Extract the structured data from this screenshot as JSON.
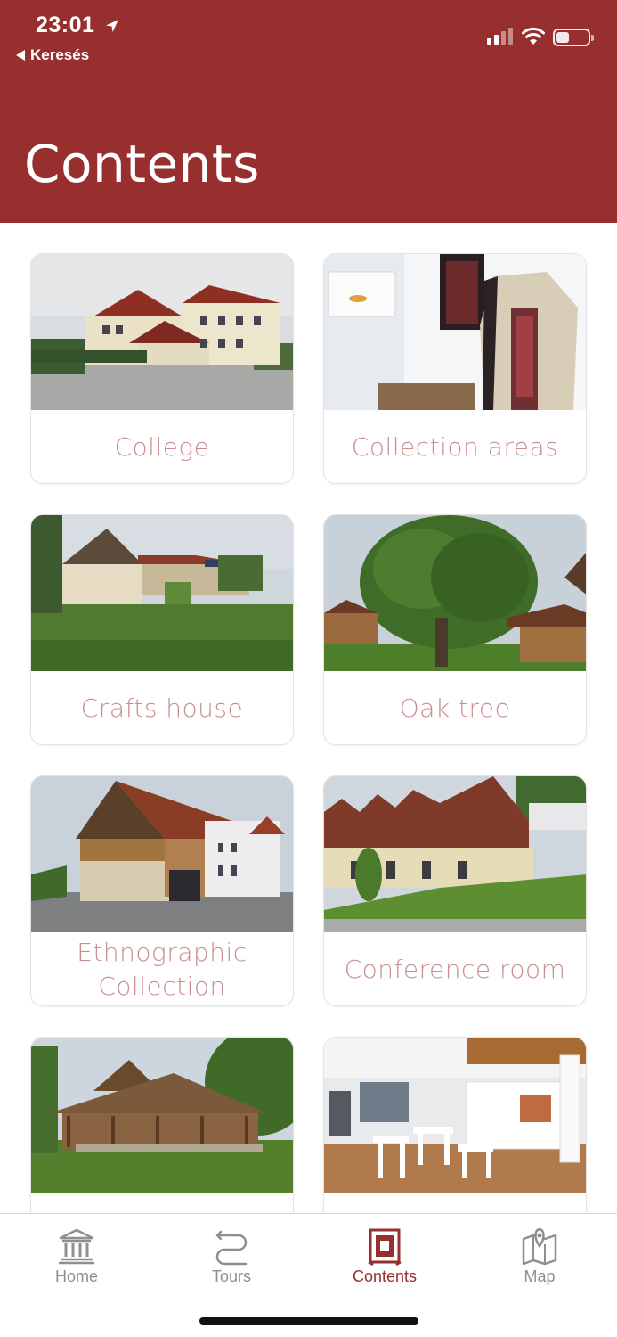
{
  "status_bar": {
    "time": "23:01",
    "back_label": "Keresés"
  },
  "header": {
    "title": "Contents"
  },
  "colors": {
    "brand": "#972f2e",
    "card_label": "#c98e90",
    "tab_inactive": "#8e8e93"
  },
  "cards": [
    {
      "label": "College",
      "image": "college-building-photo"
    },
    {
      "label": "Collection areas",
      "image": "exhibition-room-photo"
    },
    {
      "label": "Crafts house",
      "image": "crafts-house-photo"
    },
    {
      "label": "Oak tree",
      "image": "oak-tree-photo"
    },
    {
      "label": "Ethnographic Collection",
      "image": "wooden-barn-photo"
    },
    {
      "label": "Conference room",
      "image": "conference-building-photo"
    },
    {
      "label": "",
      "image": "wooden-pavilion-photo"
    },
    {
      "label": "",
      "image": "cafe-interior-photo"
    }
  ],
  "tabbar": {
    "items": [
      {
        "label": "Home",
        "icon": "museum-icon",
        "active": false
      },
      {
        "label": "Tours",
        "icon": "route-icon",
        "active": false
      },
      {
        "label": "Contents",
        "icon": "frame-icon",
        "active": true
      },
      {
        "label": "Map",
        "icon": "map-icon",
        "active": false
      }
    ]
  }
}
